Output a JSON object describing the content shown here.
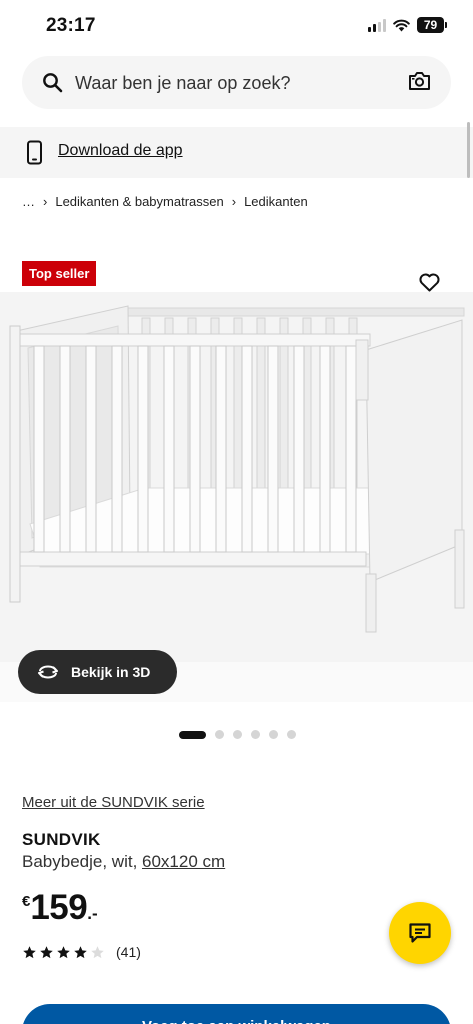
{
  "status_bar": {
    "time": "23:17",
    "battery": "79"
  },
  "search": {
    "placeholder": "Waar ben je naar op zoek?"
  },
  "download_bar": {
    "label": "Download de app"
  },
  "breadcrumb": {
    "ellipsis": "…",
    "items": [
      "Ledikanten & babymatrassen",
      "Ledikanten"
    ]
  },
  "product": {
    "badge": "Top seller",
    "view_3d_label": "Bekijk in 3D",
    "gallery": {
      "image_count": 6,
      "active_index": 0
    },
    "series_link": "Meer uit de SUNDVIK serie",
    "name": "SUNDVIK",
    "description_prefix": "Babybedje, wit, ",
    "dimensions": "60x120 cm",
    "price": {
      "currency": "€",
      "integer": "159",
      "decimal": ".-"
    },
    "rating": {
      "stars": 4,
      "max_stars": 5,
      "count": "(41)"
    },
    "cart_button_label": "Voeg toe aan winkelwagen"
  },
  "colors": {
    "badge_red": "#cc0008",
    "brand_blue": "#0058a3",
    "chat_yellow": "#ffd500"
  },
  "icons": [
    "signal-icon",
    "wifi-icon",
    "battery-icon",
    "search-icon",
    "camera-icon",
    "phone-icon",
    "chevron-right-icon",
    "heart-icon",
    "rotate-3d-icon",
    "star-icon",
    "chat-icon"
  ]
}
